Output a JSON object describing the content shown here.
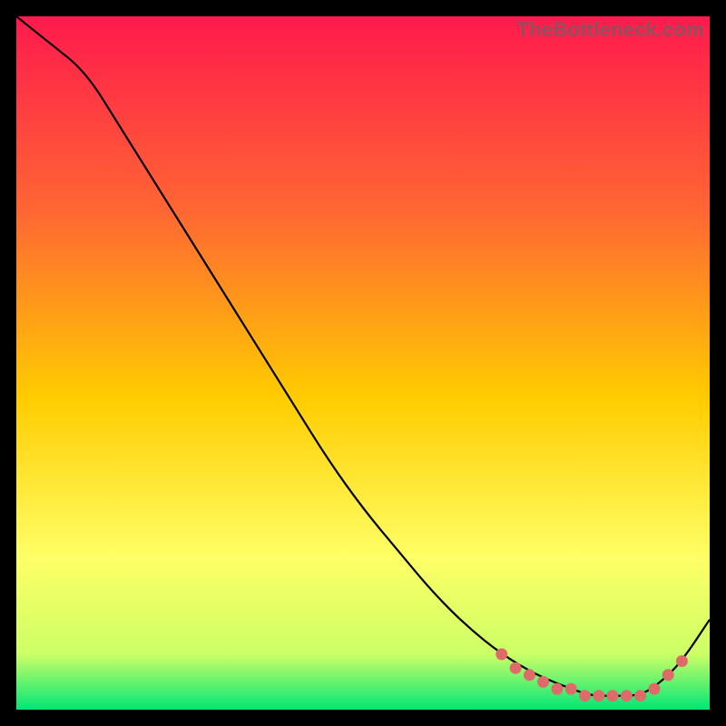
{
  "watermark": "TheBottleneck.com",
  "colors": {
    "curve_stroke": "#000000",
    "marker_fill": "#e06a6a",
    "bg_top": "#ff1a4d",
    "bg_mid1": "#ff6633",
    "bg_mid2": "#ffcc00",
    "bg_mid3": "#ffff66",
    "bg_mid4": "#ccff66",
    "bg_bottom": "#00e676"
  },
  "chart_data": {
    "type": "line",
    "title": "",
    "xlabel": "",
    "ylabel": "",
    "xlim": [
      0,
      100
    ],
    "ylim": [
      0,
      100
    ],
    "series": [
      {
        "name": "curve",
        "x": [
          0,
          5,
          10,
          15,
          20,
          25,
          30,
          35,
          40,
          45,
          50,
          55,
          60,
          65,
          70,
          75,
          80,
          83,
          86,
          90,
          93,
          96,
          100
        ],
        "values": [
          100,
          96,
          92,
          84,
          76,
          68,
          60,
          52,
          44,
          36,
          29,
          23,
          17,
          12,
          8,
          5,
          3,
          2,
          2,
          2,
          4,
          7,
          13
        ]
      }
    ],
    "markers": {
      "name": "highlight-points",
      "x": [
        70,
        72,
        74,
        76,
        78,
        80,
        82,
        84,
        86,
        88,
        90,
        92,
        94,
        96
      ],
      "values": [
        8,
        6,
        5,
        4,
        3,
        3,
        2,
        2,
        2,
        2,
        2,
        3,
        5,
        7
      ]
    }
  }
}
